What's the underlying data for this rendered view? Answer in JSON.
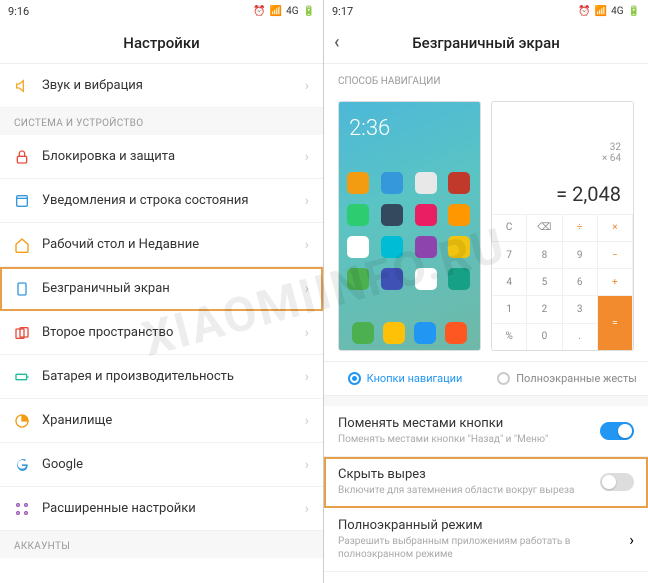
{
  "left": {
    "status": {
      "time": "9:16",
      "net": "4G"
    },
    "title": "Настройки",
    "rows": [
      {
        "name": "sound",
        "label": "Звук и вибрация",
        "color": "#f5a623"
      }
    ],
    "section1": "СИСТЕМА И УСТРОЙСТВО",
    "system_rows": [
      {
        "name": "lock",
        "label": "Блокировка и защита",
        "color": "#e74c3c"
      },
      {
        "name": "notif",
        "label": "Уведомления и строка состояния",
        "color": "#3498db"
      },
      {
        "name": "home",
        "label": "Рабочий стол и Недавние",
        "color": "#f39c12"
      },
      {
        "name": "fullscreen",
        "label": "Безграничный экран",
        "color": "#3498db",
        "hl": true
      },
      {
        "name": "second",
        "label": "Второе пространство",
        "color": "#e74c3c"
      },
      {
        "name": "battery",
        "label": "Батарея и производительность",
        "color": "#1abc9c"
      },
      {
        "name": "storage",
        "label": "Хранилище",
        "color": "#f39c12"
      },
      {
        "name": "google",
        "label": "Google",
        "color": "#3498db"
      },
      {
        "name": "advanced",
        "label": "Расширенные настройки",
        "color": "#9b59b6"
      }
    ],
    "section2": "АККАУНТЫ"
  },
  "right": {
    "status": {
      "time": "9:17",
      "net": "4G"
    },
    "title": "Безграничный экран",
    "nav_section": "СПОСОБ НАВИГАЦИИ",
    "preview_home_time": "2:36",
    "calc": {
      "expr1": "32",
      "expr2": "× 64",
      "result": "= 2,048"
    },
    "nav_opt1": "Кнопки навигации",
    "nav_opt2": "Полноэкранные жесты",
    "settings": [
      {
        "name": "swap",
        "title": "Поменять местами кнопки",
        "sub": "Поменять местами кнопки \"Назад\" и \"Меню\"",
        "on": true
      },
      {
        "name": "hidecutout",
        "title": "Скрыть вырез",
        "sub": "Включите для затемнения области вокруг выреза",
        "on": false,
        "hl": true
      },
      {
        "name": "fsmode",
        "title": "Полноэкранный режим",
        "sub": "Разрешить выбранным приложениям работать в полноэкранном режиме",
        "chev": true
      }
    ]
  },
  "watermark": "XIAOMIINFO.RU"
}
